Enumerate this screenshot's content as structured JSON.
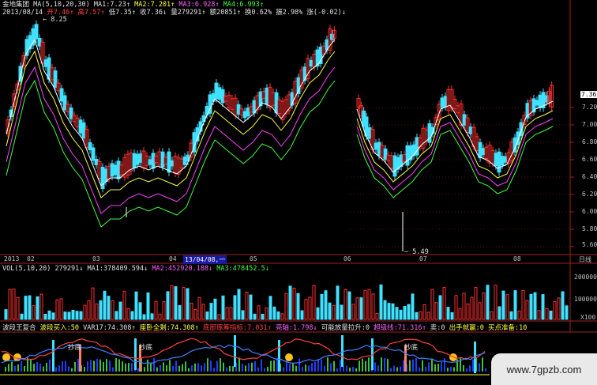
{
  "header": {
    "row1": {
      "stock_name": "金地集团",
      "ma_label": "MA(5,10,20,30)",
      "ma1": "MA1:7.23↑",
      "ma2": "MA2:7.201↑",
      "ma3": "MA3:6.928↑",
      "ma4": "MA4:6.993↑"
    },
    "row2": {
      "date": "2013/08/14",
      "open": "开7.46↑",
      "high": "高7.57↑",
      "low": "低7.35↑",
      "close": "收7.36↓",
      "volume": "量279291↑",
      "amount": "额20851↑",
      "turnover": "换0.62%",
      "amplitude": "振2.98%",
      "change": "涨(-0.02)↓"
    },
    "peak_label": "8.25",
    "low_label": "5.49"
  },
  "price_axis": [
    "7.20",
    "7.00",
    "6.80",
    "6.60",
    "6.40",
    "6.20",
    "6.00",
    "5.80",
    "5.60"
  ],
  "current_price": "7.36",
  "date_axis": {
    "year": "2013",
    "months": [
      "02",
      "03",
      "04",
      "05",
      "06",
      "07",
      "08"
    ],
    "highlight_date": "13/04/08,一",
    "period": "日线"
  },
  "volume_panel": {
    "title": "VOL(5,10,20)",
    "value": "279291↓",
    "ma1": "MA1:378409.594↓",
    "ma2": "MA2:452920.188↓",
    "ma3": "MA3:478452.5↓",
    "axis": [
      "200000",
      "100000"
    ],
    "unit": "X100"
  },
  "indicator_panel": {
    "items": [
      "波段王复合",
      "波段买入:50",
      "VAR17:74.308↑",
      "座卧全剩:74.308↑",
      "底部琢筹指标:7.031↑",
      "亮轴:1.798↓",
      "可能放量拉升:0",
      "超级线:71.316↑",
      "卖:0",
      "出手就赢:0",
      "买点准备:10"
    ],
    "labels": [
      "抄底",
      "抄底",
      "抄底"
    ]
  },
  "watermark": "www.7gpzb.com",
  "colors": {
    "up": "#ff3030",
    "down": "#40e0ff",
    "ma1": "#ffffff",
    "ma2": "#ffff40",
    "ma3": "#ff40ff",
    "ma4": "#40ff40"
  }
}
